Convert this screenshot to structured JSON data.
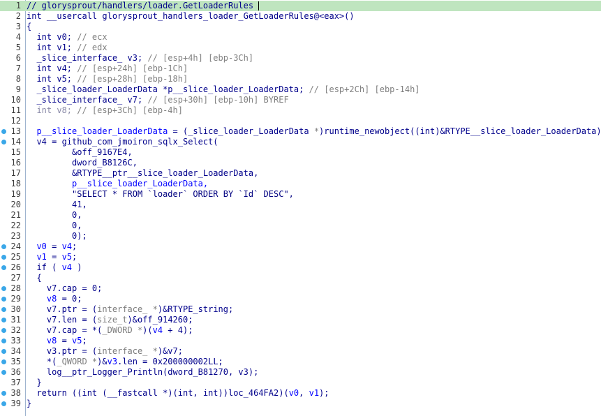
{
  "lines": [
    {
      "n": "1",
      "dot": false,
      "hl": true,
      "segs": [
        {
          "t": "// glorysprout/handlers/loader.GetLoaderRules",
          "c": "c-green"
        }
      ],
      "cursor": true
    },
    {
      "n": "2",
      "dot": false,
      "segs": [
        {
          "t": "int __usercall glorysprout_handlers_loader_GetLoaderRules@<eax>()",
          "c": ""
        }
      ]
    },
    {
      "n": "3",
      "dot": false,
      "segs": [
        {
          "t": "{",
          "c": ""
        }
      ]
    },
    {
      "n": "4",
      "dot": false,
      "segs": [
        {
          "t": "  int v0; ",
          "c": ""
        },
        {
          "t": "// ecx",
          "c": "cmt"
        }
      ]
    },
    {
      "n": "5",
      "dot": false,
      "segs": [
        {
          "t": "  int v1; ",
          "c": ""
        },
        {
          "t": "// edx",
          "c": "cmt"
        }
      ]
    },
    {
      "n": "6",
      "dot": false,
      "segs": [
        {
          "t": "  _slice_interface_ v3; ",
          "c": ""
        },
        {
          "t": "// [esp+4h] [ebp-3Ch]",
          "c": "cmt"
        }
      ]
    },
    {
      "n": "7",
      "dot": false,
      "segs": [
        {
          "t": "  int v4; ",
          "c": ""
        },
        {
          "t": "// [esp+24h] [ebp-1Ch]",
          "c": "cmt"
        }
      ]
    },
    {
      "n": "8",
      "dot": false,
      "segs": [
        {
          "t": "  int v5; ",
          "c": ""
        },
        {
          "t": "// [esp+28h] [ebp-18h]",
          "c": "cmt"
        }
      ]
    },
    {
      "n": "9",
      "dot": false,
      "segs": [
        {
          "t": "  _slice_loader_LoaderData *p__slice_loader_LoaderData; ",
          "c": ""
        },
        {
          "t": "// [esp+2Ch] [ebp-14h]",
          "c": "cmt"
        }
      ]
    },
    {
      "n": "10",
      "dot": false,
      "segs": [
        {
          "t": "  _slice_interface_ v7; ",
          "c": ""
        },
        {
          "t": "// [esp+30h] [ebp-10h] BYREF",
          "c": "cmt"
        }
      ]
    },
    {
      "n": "11",
      "dot": false,
      "segs": [
        {
          "t": "  int v8; ",
          "c": "ghost"
        },
        {
          "t": "// [esp+3Ch] [ebp-4h]",
          "c": "cmt"
        }
      ]
    },
    {
      "n": "12",
      "dot": false,
      "segs": [
        {
          "t": "",
          "c": ""
        }
      ]
    },
    {
      "n": "13",
      "dot": true,
      "segs": [
        {
          "t": "  p__slice_loader_LoaderData",
          "c": "var"
        },
        {
          "t": " = (_slice_loader_LoaderData ",
          "c": ""
        },
        {
          "t": "*",
          "c": "typ"
        },
        {
          "t": ")runtime_newobject((int)&RTYPE__slice_loader_LoaderData);",
          "c": ""
        }
      ]
    },
    {
      "n": "14",
      "dot": true,
      "segs": [
        {
          "t": "  v4 = github_com_jmoiron_sqlx_Select(",
          "c": ""
        }
      ]
    },
    {
      "n": "15",
      "dot": false,
      "segs": [
        {
          "t": "         &off_9167E4,",
          "c": ""
        }
      ]
    },
    {
      "n": "16",
      "dot": false,
      "segs": [
        {
          "t": "         dword_B8126C,",
          "c": ""
        }
      ]
    },
    {
      "n": "17",
      "dot": false,
      "segs": [
        {
          "t": "         &RTYPE__ptr__slice_loader_LoaderData,",
          "c": ""
        }
      ]
    },
    {
      "n": "18",
      "dot": false,
      "segs": [
        {
          "t": "         p__slice_loader_LoaderData,",
          "c": "var"
        }
      ]
    },
    {
      "n": "19",
      "dot": false,
      "segs": [
        {
          "t": "         \"SELECT * FROM `loader` ORDER BY `Id` DESC\",",
          "c": "str"
        }
      ]
    },
    {
      "n": "20",
      "dot": false,
      "segs": [
        {
          "t": "         41,",
          "c": ""
        }
      ]
    },
    {
      "n": "21",
      "dot": false,
      "segs": [
        {
          "t": "         0,",
          "c": ""
        }
      ]
    },
    {
      "n": "22",
      "dot": false,
      "segs": [
        {
          "t": "         0,",
          "c": ""
        }
      ]
    },
    {
      "n": "23",
      "dot": false,
      "segs": [
        {
          "t": "         0);",
          "c": ""
        }
      ]
    },
    {
      "n": "24",
      "dot": true,
      "segs": [
        {
          "t": "  v0",
          "c": "var"
        },
        {
          "t": " = ",
          "c": ""
        },
        {
          "t": "v4",
          "c": "var"
        },
        {
          "t": ";",
          "c": ""
        }
      ]
    },
    {
      "n": "25",
      "dot": true,
      "segs": [
        {
          "t": "  v1",
          "c": "var"
        },
        {
          "t": " = ",
          "c": ""
        },
        {
          "t": "v5",
          "c": "var"
        },
        {
          "t": ";",
          "c": ""
        }
      ]
    },
    {
      "n": "26",
      "dot": true,
      "segs": [
        {
          "t": "  if ( ",
          "c": ""
        },
        {
          "t": "v4",
          "c": "var"
        },
        {
          "t": " )",
          "c": ""
        }
      ]
    },
    {
      "n": "27",
      "dot": false,
      "segs": [
        {
          "t": "  {",
          "c": ""
        }
      ]
    },
    {
      "n": "28",
      "dot": true,
      "segs": [
        {
          "t": "    v7.cap = 0;",
          "c": ""
        }
      ]
    },
    {
      "n": "29",
      "dot": true,
      "segs": [
        {
          "t": "    v8",
          "c": "var"
        },
        {
          "t": " = 0;",
          "c": ""
        }
      ]
    },
    {
      "n": "30",
      "dot": true,
      "segs": [
        {
          "t": "    v7.ptr = (",
          "c": ""
        },
        {
          "t": "interface_ *",
          "c": "typ"
        },
        {
          "t": ")&RTYPE_string;",
          "c": ""
        }
      ]
    },
    {
      "n": "31",
      "dot": true,
      "segs": [
        {
          "t": "    v7.len = (",
          "c": ""
        },
        {
          "t": "size_t",
          "c": "typ"
        },
        {
          "t": ")&off_914260;",
          "c": ""
        }
      ]
    },
    {
      "n": "32",
      "dot": true,
      "segs": [
        {
          "t": "    v7.cap = *(",
          "c": ""
        },
        {
          "t": "_DWORD *",
          "c": "typ"
        },
        {
          "t": ")(",
          "c": ""
        },
        {
          "t": "v4",
          "c": "var"
        },
        {
          "t": " + 4);",
          "c": ""
        }
      ]
    },
    {
      "n": "33",
      "dot": true,
      "segs": [
        {
          "t": "    v8",
          "c": "var"
        },
        {
          "t": " = ",
          "c": ""
        },
        {
          "t": "v5",
          "c": "var"
        },
        {
          "t": ";",
          "c": ""
        }
      ]
    },
    {
      "n": "34",
      "dot": true,
      "segs": [
        {
          "t": "    v3.ptr = (",
          "c": ""
        },
        {
          "t": "interface_ *",
          "c": "typ"
        },
        {
          "t": ")&v7;",
          "c": ""
        }
      ]
    },
    {
      "n": "35",
      "dot": true,
      "segs": [
        {
          "t": "    *(",
          "c": ""
        },
        {
          "t": "_QWORD *",
          "c": "typ"
        },
        {
          "t": ")&",
          "c": ""
        },
        {
          "t": "v3",
          "c": "var"
        },
        {
          "t": ".len = 0x200000002LL;",
          "c": ""
        }
      ]
    },
    {
      "n": "36",
      "dot": true,
      "segs": [
        {
          "t": "    log__ptr_Logger_Println(dword_B81270, v3);",
          "c": ""
        }
      ]
    },
    {
      "n": "37",
      "dot": false,
      "segs": [
        {
          "t": "  }",
          "c": ""
        }
      ]
    },
    {
      "n": "38",
      "dot": true,
      "segs": [
        {
          "t": "  return ((int (__fastcall *)(int, int))loc_464FA2)(",
          "c": ""
        },
        {
          "t": "v0",
          "c": "var"
        },
        {
          "t": ", ",
          "c": ""
        },
        {
          "t": "v1",
          "c": "var"
        },
        {
          "t": ");",
          "c": ""
        }
      ]
    },
    {
      "n": "39",
      "dot": true,
      "segs": [
        {
          "t": "}",
          "c": ""
        }
      ]
    }
  ]
}
